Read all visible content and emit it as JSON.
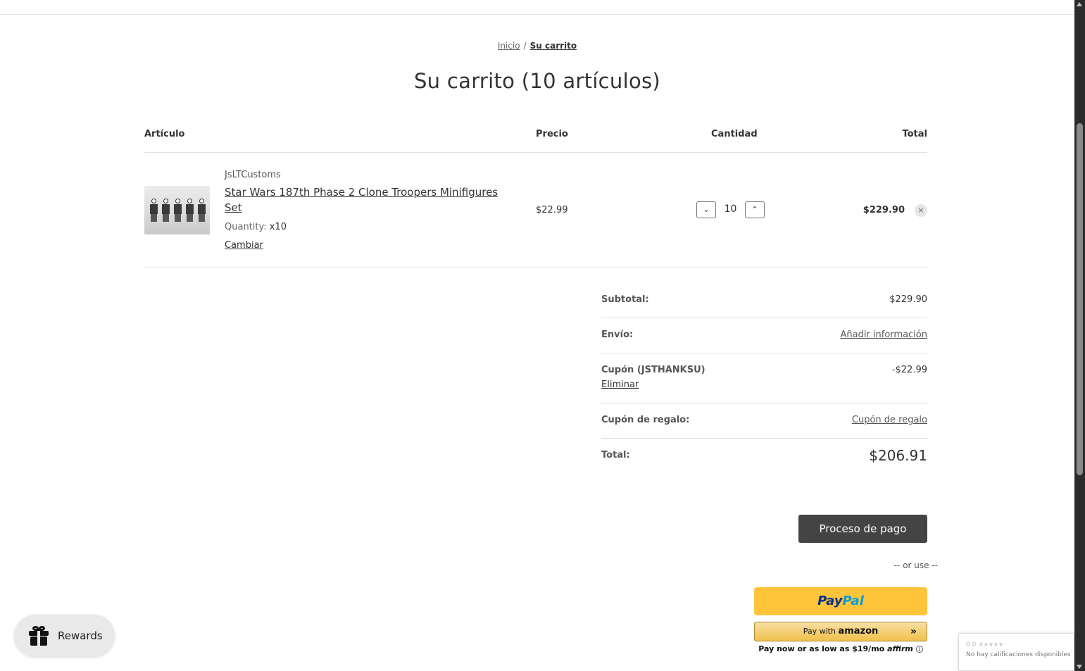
{
  "breadcrumb": {
    "home": "Inicio",
    "separator": "/",
    "current": "Su carrito"
  },
  "page_title": "Su carrito (10 artículos)",
  "table": {
    "headers": {
      "item": "Artículo",
      "price": "Precio",
      "quantity": "Cantidad",
      "total": "Total"
    }
  },
  "cart_item": {
    "vendor": "JsLTCustoms",
    "name": "Star Wars 187th Phase 2 Clone Troopers Minifigures Set",
    "option_label": "Quantity:",
    "option_value": "x10",
    "change_label": "Cambiar",
    "price": "$22.99",
    "quantity": "10",
    "line_total": "$229.90",
    "remove_symbol": "×"
  },
  "totals": {
    "subtotal_label": "Subtotal:",
    "subtotal_value": "$229.90",
    "shipping_label": "Envío:",
    "shipping_link": "Añadir información",
    "coupon_label": "Cupón (JSTHANKSU)",
    "coupon_value": "-$22.99",
    "coupon_remove": "Eliminar",
    "gift_label": "Cupón de regalo:",
    "gift_link": "Cupón de regalo",
    "total_label": "Total:",
    "total_value": "$206.91"
  },
  "checkout": {
    "button_label": "Proceso de pago",
    "or_use": "-- or use --",
    "paypal_part1": "Pay",
    "paypal_part2": "Pal",
    "amazon_prefix": "Pay with",
    "amazon_brand": "amazon",
    "amazon_chevron": "»",
    "affirm_text": "Pay now or as low as $19/mo",
    "affirm_logo": "affirm",
    "affirm_info": "i"
  },
  "rewards": {
    "label": "Rewards"
  },
  "rating_badge": {
    "score": "0.0",
    "stars": "★★★★★",
    "text": "No hay calificaciones disponibles"
  },
  "colors": {
    "checkout_button": "#444444",
    "paypal_bg": "#ffc439",
    "paypal_blue_dark": "#003087",
    "paypal_blue_light": "#009cde",
    "amazon_bg": "#f0c14b"
  }
}
